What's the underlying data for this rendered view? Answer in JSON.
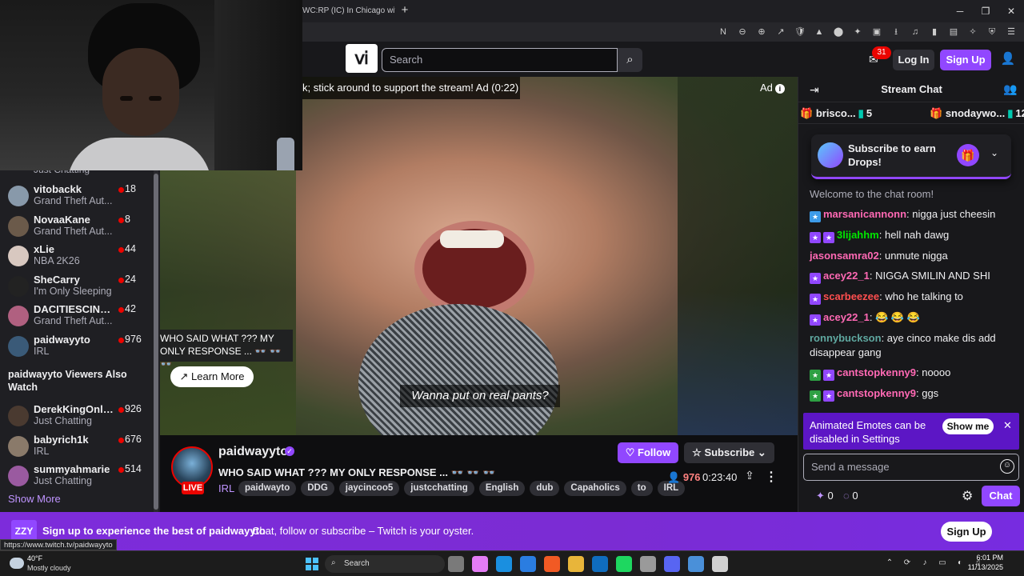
{
  "browser": {
    "tab_title": "WC:RP (IC) In Chicago with Bl",
    "new_tab": "+",
    "window_controls": [
      "─",
      "❐",
      "✕"
    ],
    "extension_icons": [
      "N",
      "⊖",
      "⊕",
      "↗",
      "🛡",
      "▲",
      "⬤",
      "✦",
      "▣",
      "⭳",
      "♫",
      "▮",
      "▤",
      "✧",
      "⛨",
      "☰"
    ]
  },
  "webcam": {},
  "nav": {
    "logo": "ⅵ",
    "search_placeholder": "Search",
    "search_icon": "⌕",
    "inbox_icon": "✉",
    "inbox_count": "31",
    "login": "Log In",
    "signup": "Sign Up",
    "user_icon": "👤"
  },
  "sidebar": {
    "partial_top_label": "Just Chatting",
    "channels": [
      {
        "name": "vitobackk",
        "game": "Grand Theft Aut...",
        "viewers": "18",
        "color": "#8899aa"
      },
      {
        "name": "NovaaKane",
        "game": "Grand Theft Aut...",
        "viewers": "8",
        "color": "#6b5a4a"
      },
      {
        "name": "xLie",
        "game": "NBA 2K26",
        "viewers": "44",
        "color": "#d8c8c0"
      },
      {
        "name": "SheCarry",
        "game": "I'm Only Sleeping",
        "viewers": "24",
        "color": "#222222"
      },
      {
        "name": "DACITIESCINDE...",
        "game": "Grand Theft Aut...",
        "viewers": "42",
        "color": "#b06080"
      },
      {
        "name": "paidwayyto",
        "game": "IRL",
        "viewers": "976",
        "color": "#3a5a78"
      }
    ],
    "also_watch_heading": "paidwayyto Viewers Also Watch",
    "also_watch": [
      {
        "name": "DerekKingOnline",
        "game": "Just Chatting",
        "viewers": "926",
        "color": "#4a3a30"
      },
      {
        "name": "babyrich1k",
        "game": "IRL",
        "viewers": "676",
        "color": "#8a7a6a"
      },
      {
        "name": "summyahmarie",
        "game": "Just Chatting",
        "viewers": "514",
        "color": "#9a5aa0"
      }
    ],
    "show_more": "Show More"
  },
  "video": {
    "ad_notice": "k; stick around to support the stream! Ad (0:22)",
    "ad_label": "Ad",
    "ad_info_icon": "i",
    "subtitle": "Wanna put on real pants?",
    "tooltip": "WHO SAID WHAT ??? MY ONLY RESPONSE ... 👓 👓 👓",
    "learn_more": "Learn More",
    "learn_more_icon": "↗"
  },
  "stream": {
    "channel_name": "paidwayyto",
    "verified_icon": "✓",
    "live_label": "LIVE",
    "title": "WHO SAID WHAT ??? MY ONLY RESPONSE ... 👓 👓 👓",
    "category": "IRL",
    "tags": [
      "paidwayto",
      "DDG",
      "jaycincoo5",
      "justcchatting",
      "English",
      "dub",
      "Capaholics",
      "to",
      "IRL"
    ],
    "follow": "Follow",
    "follow_icon": "♡",
    "subscribe": "Subscribe",
    "subscribe_icon": "☆",
    "subscribe_chevron": "⌄",
    "viewers_icon": "👤",
    "viewer_count": "976",
    "uptime": "0:23:40",
    "share_icon": "⇪",
    "more_icon": "⋮"
  },
  "chat": {
    "collapse_icon": "⇥",
    "title": "Stream Chat",
    "users_icon": "👥",
    "gift_leaders": [
      {
        "name": "brisco...",
        "count": "5"
      },
      {
        "name": "snodaywo...",
        "count": "12"
      }
    ],
    "gift_icon": "🎁",
    "drops_text": "Subscribe to earn Drops!",
    "drops_gift_icon": "🎁",
    "drops_chevron": "⌄",
    "welcome": "Welcome to the chat room!",
    "messages": [
      {
        "badges": [
          "#3d9be9"
        ],
        "user": "marsanicannonn",
        "color": "#ff69b4",
        "text": ": nigga just cheesin"
      },
      {
        "badges": [
          "#9147ff",
          "#9147ff"
        ],
        "user": "3lijahhm",
        "color": "#00e600",
        "text": ": hell nah dawg"
      },
      {
        "badges": [],
        "user": "jasonsamra02",
        "color": "#ff69b4",
        "text": ": unmute nigga"
      },
      {
        "badges": [
          "#9147ff"
        ],
        "user": "acey22_1",
        "color": "#ff69b4",
        "text": ": NIGGA SMILIN AND SHI"
      },
      {
        "badges": [
          "#9147ff"
        ],
        "user": "scarbeezee",
        "color": "#ff4f4f",
        "text": ": who he talking to"
      },
      {
        "badges": [
          "#9147ff"
        ],
        "user": "acey22_1",
        "color": "#ff69b4",
        "text": ": 😂 😂 😂"
      },
      {
        "badges": [],
        "user": "ronnybuckson",
        "color": "#5fa8a0",
        "text": ": aye cinco make dis add disappear gang"
      },
      {
        "badges": [
          "#2ea043",
          "#9147ff"
        ],
        "user": "cantstopkenny9",
        "color": "#ff69b4",
        "text": ": noooo"
      },
      {
        "badges": [
          "#2ea043",
          "#9147ff"
        ],
        "user": "cantstopkenny9",
        "color": "#ff69b4",
        "text": ": ggs"
      }
    ],
    "anim_notice": "Animated Emotes can be disabled in Settings",
    "show_me": "Show me",
    "close_icon": "✕",
    "input_placeholder": "Send a message",
    "emote_icon": "☺",
    "points_a": "0",
    "points_b": "0",
    "points_icon_a": "✦",
    "points_icon_b": "◌",
    "settings_icon": "⚙",
    "chat_button": "Chat"
  },
  "banner": {
    "logo": "ZZY",
    "title": "Sign up to experience the best of paidwayyto",
    "subtitle": "Chat, follow or subscribe – Twitch is your oyster.",
    "signup": "Sign Up",
    "status_url": "https://www.twitch.tv/paidwayyto"
  },
  "taskbar": {
    "temp": "40°F",
    "weather": "Mostly cloudy",
    "search": "Search",
    "search_icon": "⌕",
    "app_colors": [
      "#7a7a7a",
      "#e47cf5",
      "#1a8fe0",
      "#2a7de1",
      "#f15a24",
      "#e8b53a",
      "#0f6cbd",
      "#1ed760",
      "#9a9a9a",
      "#5865f2",
      "#4a90d9",
      "#d0d0d0"
    ],
    "tray_icons": [
      "⌃",
      "⟳",
      "♪",
      "▭",
      "◐",
      "♫"
    ],
    "time": "6:01 PM",
    "date": "11/13/2025"
  }
}
